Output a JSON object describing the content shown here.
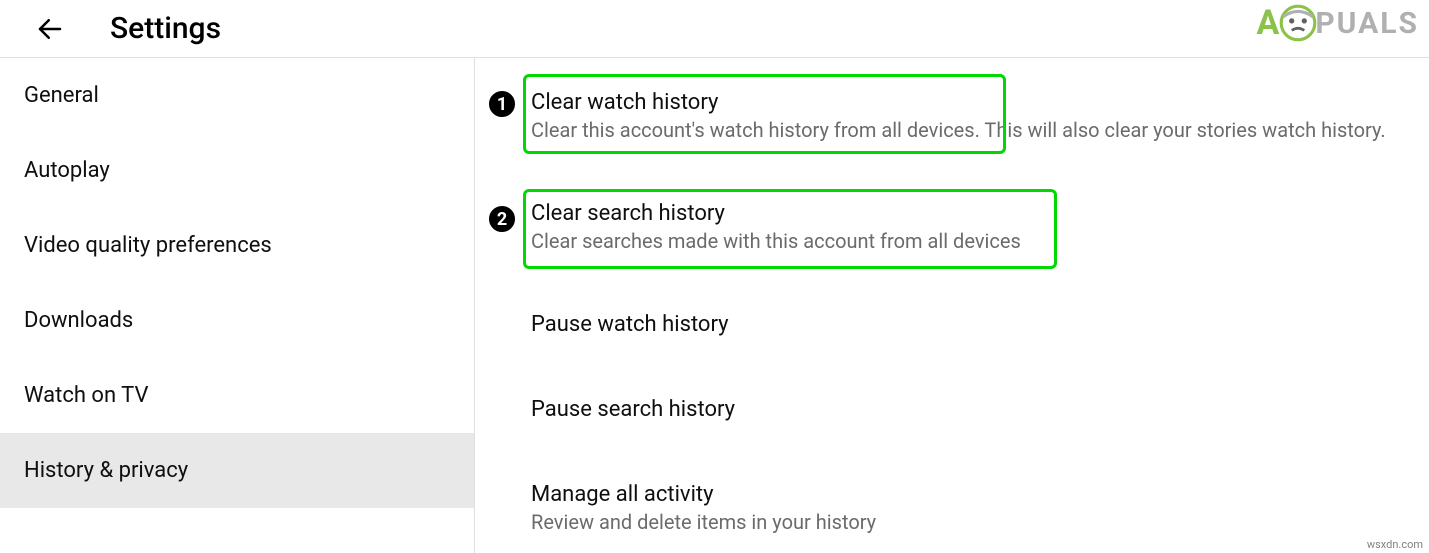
{
  "header": {
    "title": "Settings"
  },
  "sidebar": {
    "items": [
      {
        "label": "General"
      },
      {
        "label": "Autoplay"
      },
      {
        "label": "Video quality preferences"
      },
      {
        "label": "Downloads"
      },
      {
        "label": "Watch on TV"
      },
      {
        "label": "History & privacy"
      }
    ],
    "activeIndex": 5
  },
  "main": {
    "options": [
      {
        "title": "Clear watch history",
        "sub_inside": "Clear this account's watch history from all devices.",
        "sub_outside": " This will also clear your stories watch history."
      },
      {
        "title": "Clear search history",
        "sub_inside": "Clear searches made with this account from all devices"
      },
      {
        "title": "Pause watch history"
      },
      {
        "title": "Pause search history"
      },
      {
        "title": "Manage all activity",
        "sub_inside": "Review and delete items in your history"
      }
    ]
  },
  "annotations": {
    "badge1": "1",
    "badge2": "2"
  },
  "watermark": {
    "text_left": "A",
    "text_right": "PUALS",
    "credit": "wsxdn.com"
  }
}
